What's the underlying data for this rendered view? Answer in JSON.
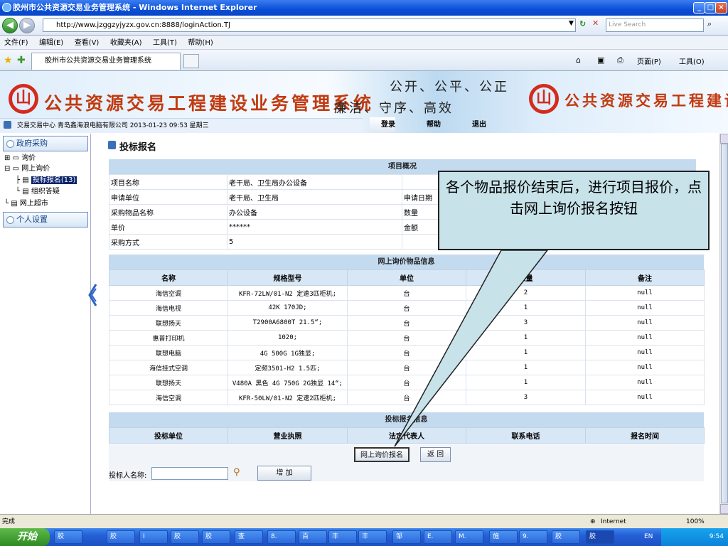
{
  "window": {
    "title": "胶州市公共资源交易业务管理系统 - Windows Internet Explorer",
    "min": "_",
    "max": "□",
    "close": "×"
  },
  "browser": {
    "url": "http://www.jzggzyjyzx.gov.cn:8888/loginAction.TJ",
    "search_placeholder": "Live Search",
    "menus": [
      "文件(F)",
      "编辑(E)",
      "查看(V)",
      "收藏夹(A)",
      "工具(T)",
      "帮助(H)"
    ],
    "tab_title": "胶州市公共资源交易业务管理系统",
    "cmd_page": "页面(P)",
    "cmd_tools": "工具(O)"
  },
  "banner": {
    "title": "公共资源交易工程建设业务管理系统",
    "motto_top": "公开、公平、公正",
    "motto_bottom": "廉洁、守序、高效",
    "title_right": "公共资源交易工程建设业",
    "user_line": "交易交易中心 青岛鑫海浪电脑有限公司 2013-01-23 09:53 星期三",
    "login": "登录",
    "help": "帮助",
    "logout": "退出"
  },
  "sidebar": {
    "section1": "政府采购",
    "tree": [
      "询价",
      "网上询价",
      "投标报名(13)",
      "组织答疑",
      "网上超市"
    ],
    "section2": "个人设置"
  },
  "page": {
    "title": "投标报名",
    "overview": {
      "heading": "项目概况",
      "rows": [
        {
          "label": "项目名称",
          "value": "老干局、卫生局办公设备",
          "label2": "",
          "value2": ""
        },
        {
          "label": "申请单位",
          "value": "老干局、卫生局",
          "label2": "申请日期",
          "value2": ""
        },
        {
          "label": "采购物品名称",
          "value": "办公设备",
          "label2": "数量",
          "value2": ""
        },
        {
          "label": "单价",
          "value": "******",
          "label2": "金额",
          "value2": ""
        },
        {
          "label": "采购方式",
          "value": "5",
          "label2": "",
          "value2": ""
        }
      ]
    },
    "goods": {
      "heading": "网上询价物品信息",
      "columns": [
        "名称",
        "规格型号",
        "单位",
        "数量",
        "备注"
      ],
      "rows": [
        [
          "海信空调",
          "KFR-72LW/01-N2 定速3匹柜机;",
          "台",
          "2",
          "null"
        ],
        [
          "海信电视",
          "42K 170JD;",
          "台",
          "1",
          "null"
        ],
        [
          "联想扬天",
          "T2900A6800T 21.5“;",
          "台",
          "3",
          "null"
        ],
        [
          "惠普打印机",
          "1020;",
          "台",
          "1",
          "null"
        ],
        [
          "联想电脑",
          "4G 500G 1G独显;",
          "台",
          "1",
          "null"
        ],
        [
          "海信挂式空调",
          "定频3501-H2 1.5匹;",
          "台",
          "1",
          "null"
        ],
        [
          "联想扬天",
          "V480A 黑色 4G 750G 2G独显 14“;",
          "台",
          "1",
          "null"
        ],
        [
          "海信空调",
          "KFR-50LW/01-N2 定速2匹柜机;",
          "台",
          "3",
          "null"
        ]
      ]
    },
    "bid": {
      "heading": "投标报名信息",
      "columns": [
        "投标单位",
        "营业执照",
        "法定代表人",
        "联系电话",
        "报名时间"
      ]
    },
    "btn_register": "网上询价报名",
    "btn_back": "返 回",
    "bidder_label": "投标人名称:",
    "bidder_value": "",
    "btn_add": "增 加"
  },
  "callout": {
    "text": "各个物品报价结束后，进行项目报价，点击网上询价报名按钮"
  },
  "status": {
    "left": "完成",
    "zone": "Internet",
    "zoom": "100%"
  },
  "taskbar": {
    "start": "开始",
    "items": [
      "胶",
      "胶",
      "I",
      "胶",
      "胶",
      "查",
      "8.",
      "百",
      "丰",
      "丰",
      "邹",
      "E.",
      "M.",
      "施",
      "9.",
      "胶",
      "胶"
    ],
    "lang": "EN",
    "clock": "9:54"
  },
  "colors": {
    "accent": "#0a4fd8",
    "header_bg": "#c3daef",
    "callout_bg": "#c7e2e9"
  }
}
